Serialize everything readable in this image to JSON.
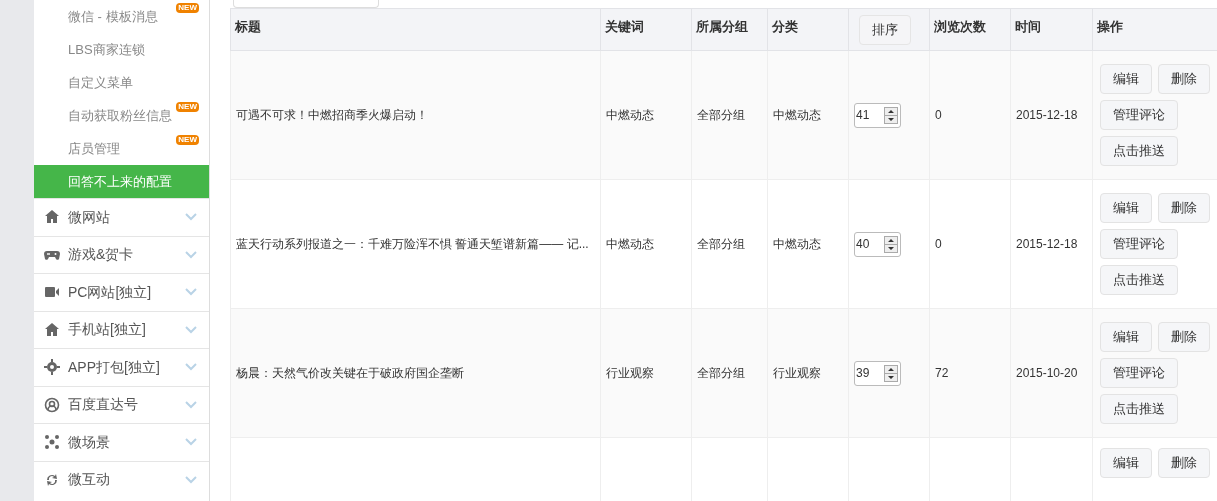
{
  "sidebar": {
    "submenu": [
      {
        "label": "微信 - 模板消息",
        "badge": "NEW",
        "selected": false
      },
      {
        "label": "LBS商家连锁",
        "selected": false
      },
      {
        "label": "自定义菜单",
        "selected": false
      },
      {
        "label": "自动获取粉丝信息",
        "badge": "NEW",
        "selected": false
      },
      {
        "label": "店员管理",
        "badge": "NEW",
        "selected": false
      },
      {
        "label": "回答不上来的配置",
        "selected": true
      }
    ],
    "menu": [
      {
        "label": "微网站",
        "expanded": false
      },
      {
        "label": "游戏&贺卡",
        "expanded": false
      },
      {
        "label": "PC网站[独立]",
        "expanded": false
      },
      {
        "label": "手机站[独立]",
        "expanded": false
      },
      {
        "label": "APP打包[独立]",
        "expanded": false
      },
      {
        "label": "百度直达号",
        "expanded": false
      },
      {
        "label": "微场景",
        "expanded": false
      },
      {
        "label": "微互动",
        "expanded": false
      }
    ]
  },
  "table": {
    "columns": [
      "标题",
      "关键词",
      "所属分组",
      "分类",
      "排序",
      "浏览次数",
      "时间",
      "操作"
    ],
    "rows": [
      {
        "title": "可遇不可求！中燃招商季火爆启动！",
        "keyword": "中燃动态",
        "group": "全部分组",
        "category": "中燃动态",
        "order": "41",
        "views": "0",
        "time": "2015-12-18",
        "actions": [
          "编辑",
          "删除",
          "管理评论",
          "点击推送"
        ]
      },
      {
        "title": "蓝天行动系列报道之一：千难万险浑不惧 誓通天堑谱新篇—— 记...",
        "keyword": "中燃动态",
        "group": "全部分组",
        "category": "中燃动态",
        "order": "40",
        "views": "0",
        "time": "2015-12-18",
        "actions": [
          "编辑",
          "删除",
          "管理评论",
          "点击推送"
        ]
      },
      {
        "title": "杨晨：天然气价改关键在于破政府国企垄断",
        "keyword": "行业观察",
        "group": "全部分组",
        "category": "行业观察",
        "order": "39",
        "views": "72",
        "time": "2015-10-20",
        "actions": [
          "编辑",
          "删除",
          "管理评论",
          "点击推送"
        ]
      },
      {
        "actions": [
          "编辑",
          "删除"
        ]
      }
    ]
  }
}
